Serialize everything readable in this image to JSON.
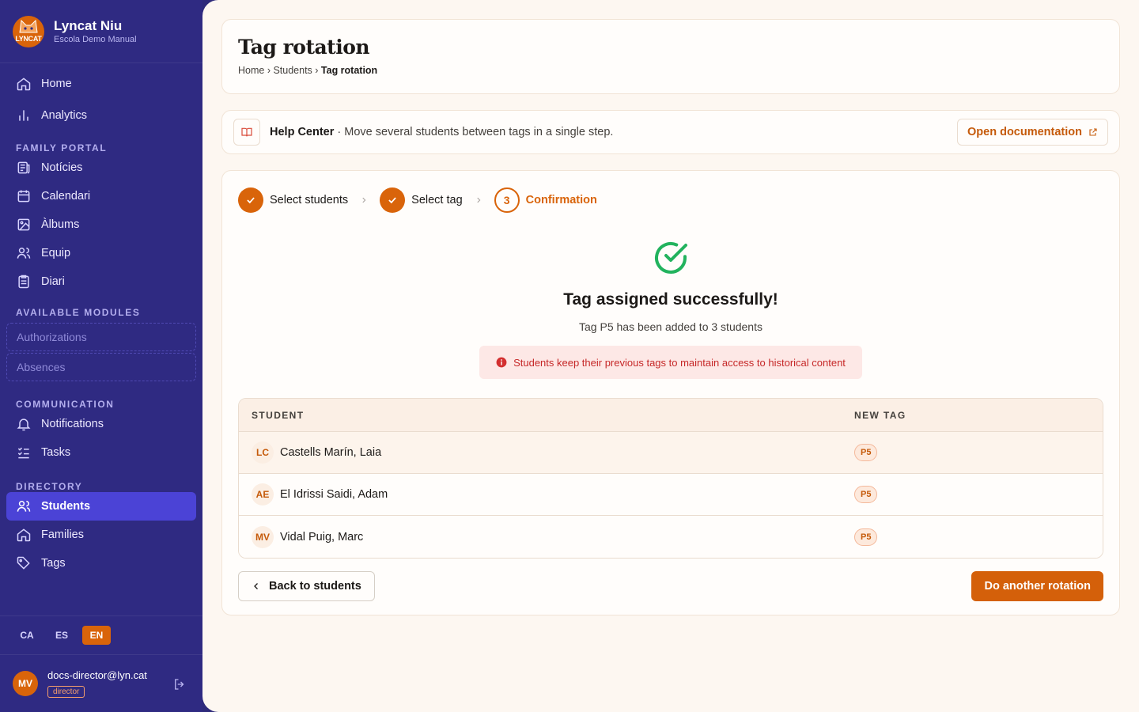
{
  "brand": {
    "name": "Lyncat Niu",
    "subtitle": "Escola Demo Manual",
    "logo_text": "LYNCAT"
  },
  "nav_top": [
    {
      "label": "Home",
      "icon": "home-icon"
    },
    {
      "label": "Analytics",
      "icon": "chart-icon"
    }
  ],
  "sections": {
    "family_portal": "FAMILY PORTAL",
    "available_modules": "AVAILABLE MODULES",
    "communication": "COMMUNICATION",
    "directory": "DIRECTORY"
  },
  "family_portal": [
    {
      "label": "Notícies",
      "icon": "newspaper-icon"
    },
    {
      "label": "Calendari",
      "icon": "calendar-icon"
    },
    {
      "label": "Àlbums",
      "icon": "image-icon"
    },
    {
      "label": "Equip",
      "icon": "users-icon"
    },
    {
      "label": "Diari",
      "icon": "clipboard-icon"
    }
  ],
  "modules": [
    "Authorizations",
    "Absences"
  ],
  "communication": [
    {
      "label": "Notifications",
      "icon": "bell-icon"
    },
    {
      "label": "Tasks",
      "icon": "list-check-icon"
    }
  ],
  "directory": [
    {
      "label": "Students",
      "icon": "users-icon",
      "active": true
    },
    {
      "label": "Families",
      "icon": "home-icon"
    },
    {
      "label": "Tags",
      "icon": "tag-icon"
    }
  ],
  "languages": [
    "CA",
    "ES",
    "EN"
  ],
  "active_language": "EN",
  "user": {
    "initials": "MV",
    "email": "docs-director@lyn.cat",
    "role": "director"
  },
  "header": {
    "title": "Tag rotation",
    "breadcrumb": [
      "Home",
      "Students",
      "Tag rotation"
    ]
  },
  "help": {
    "title": "Help Center",
    "text": " · Move several students between tags in a single step.",
    "button": "Open documentation"
  },
  "steps": [
    {
      "label": "Select students",
      "state": "done"
    },
    {
      "label": "Select tag",
      "state": "done"
    },
    {
      "label": "Confirmation",
      "number": "3",
      "state": "current"
    }
  ],
  "result": {
    "title": "Tag assigned successfully!",
    "subtitle": "Tag P5 has been added to 3 students",
    "alert": "Students keep their previous tags to maintain access to historical content"
  },
  "table": {
    "headers": [
      "STUDENT",
      "NEW TAG"
    ],
    "rows": [
      {
        "initials": "LC",
        "name": "Castells Marín, Laia",
        "tag": "P5"
      },
      {
        "initials": "AE",
        "name": "El Idrissi Saidi, Adam",
        "tag": "P5"
      },
      {
        "initials": "MV",
        "name": "Vidal Puig, Marc",
        "tag": "P5"
      }
    ]
  },
  "actions": {
    "back": "Back to students",
    "primary": "Do another rotation"
  },
  "colors": {
    "sidebar": "#2f2a82",
    "accent": "#d9640a",
    "active_nav": "#4b43d6",
    "success": "#22b35e"
  }
}
